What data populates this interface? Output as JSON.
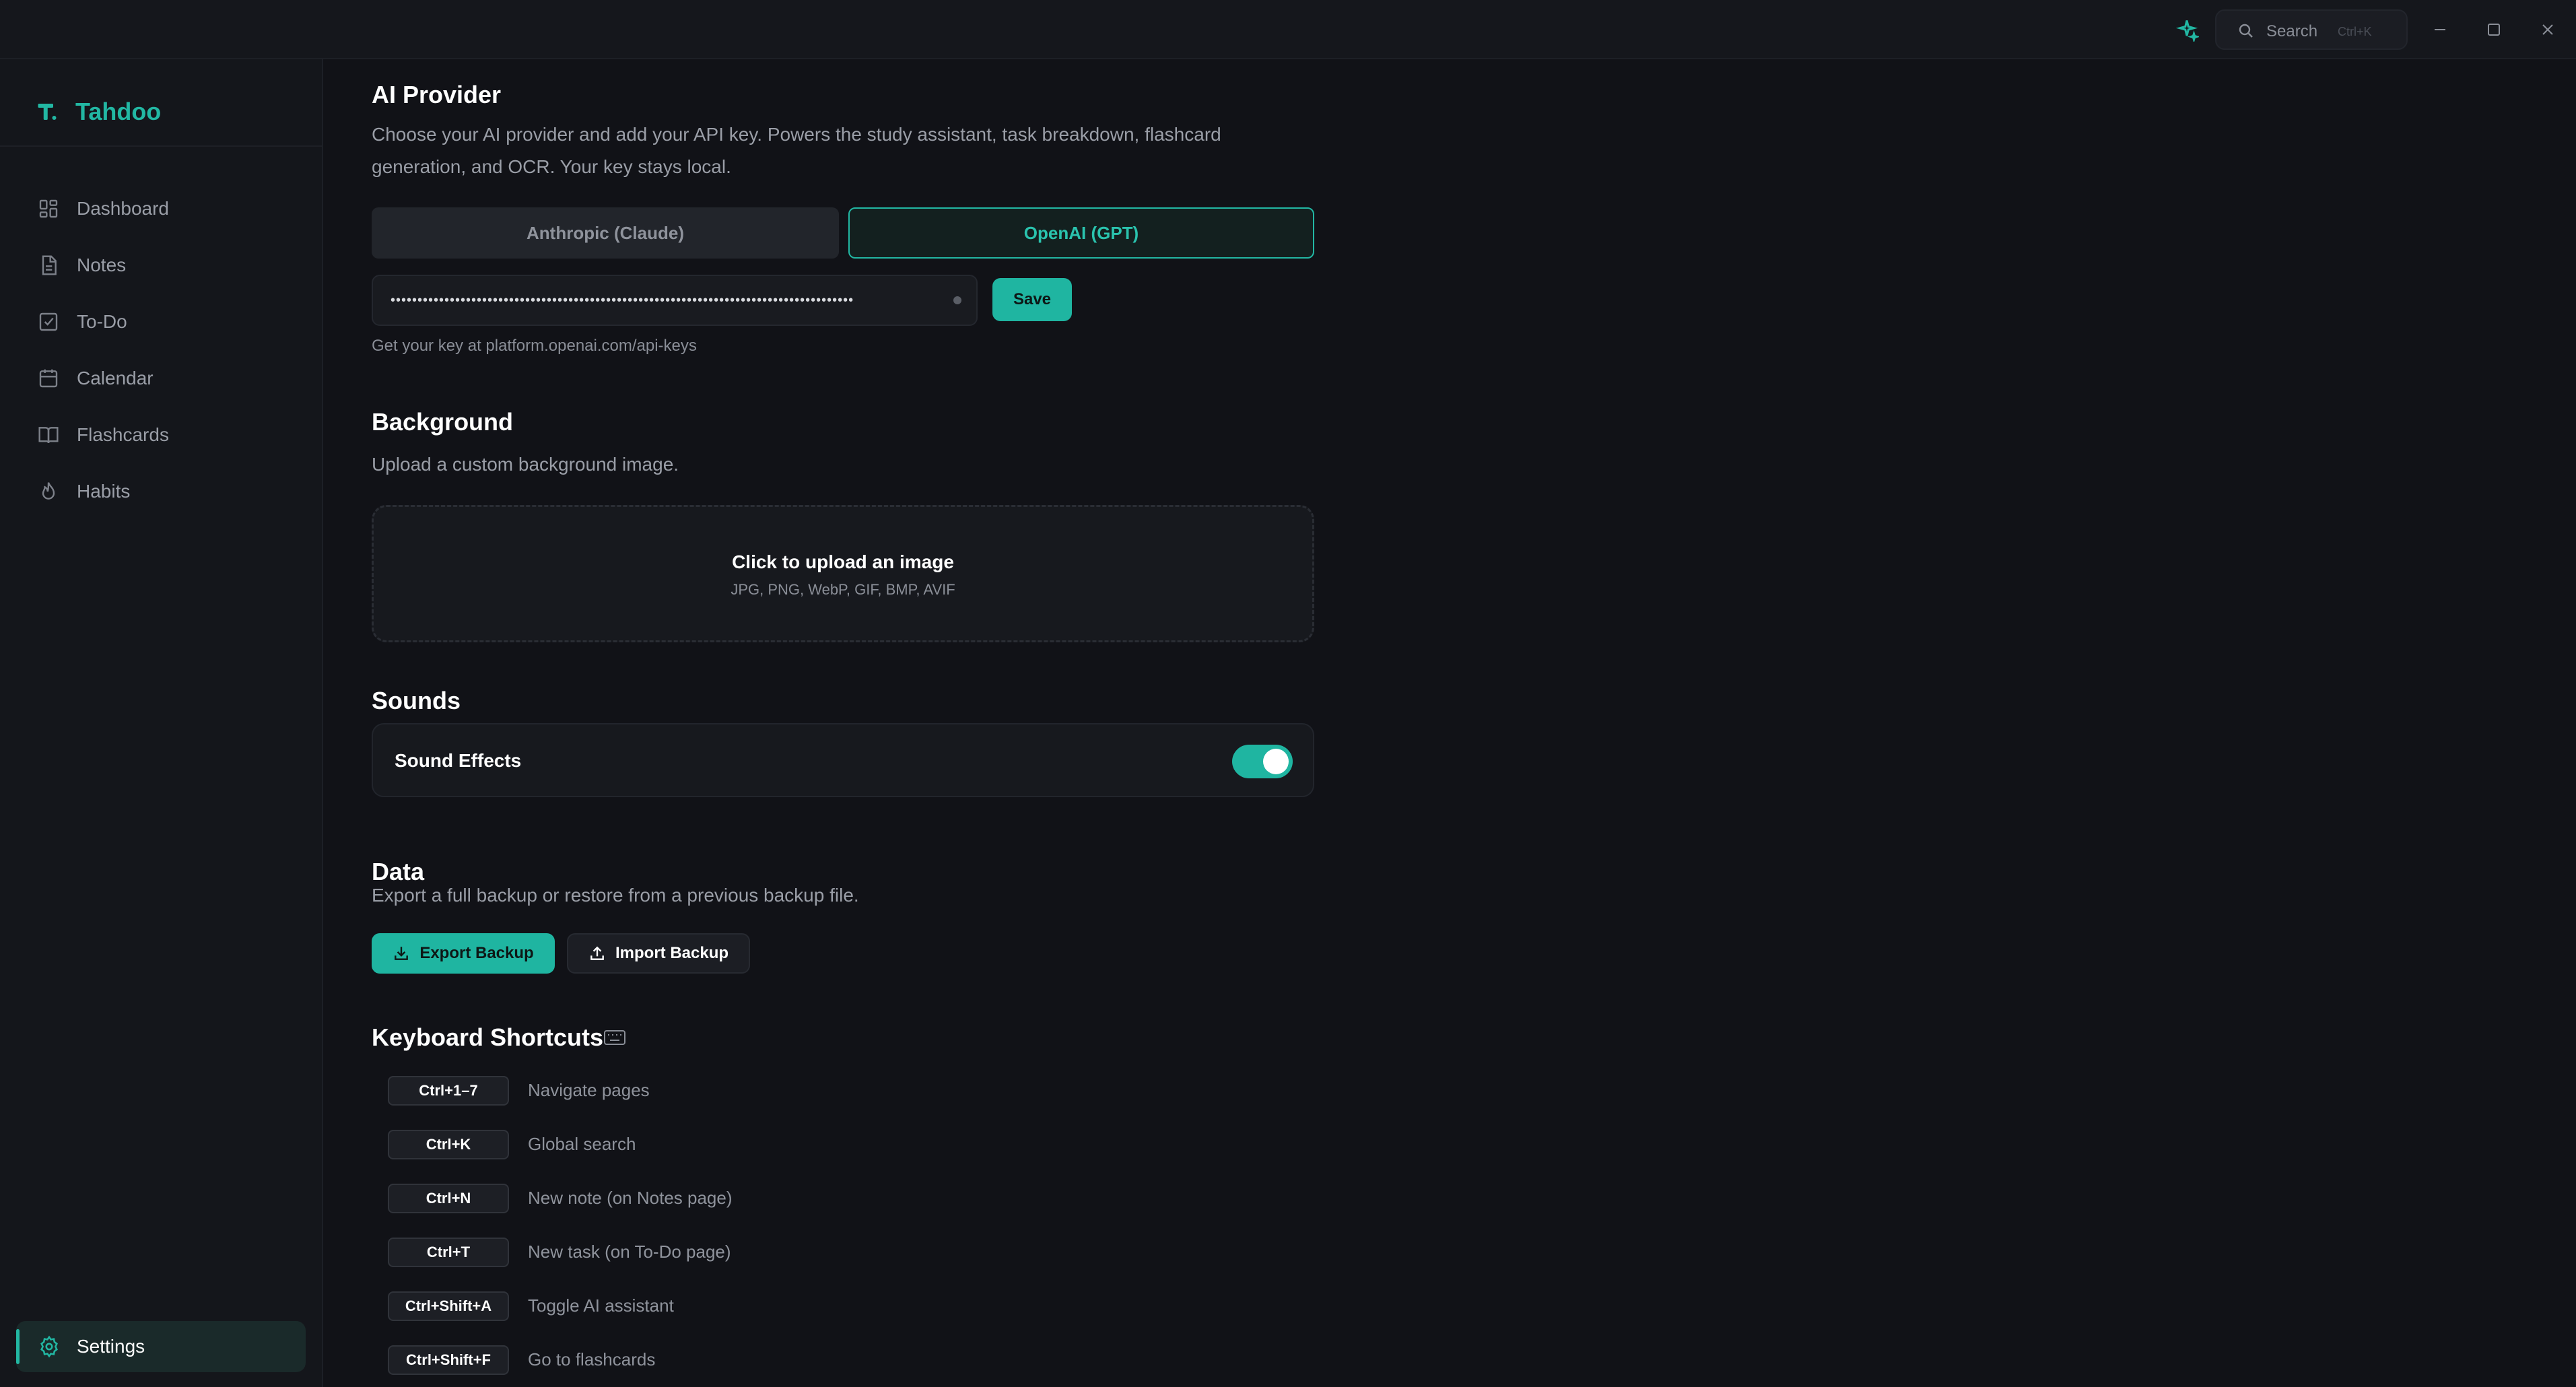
{
  "titlebar": {
    "search_label": "Search",
    "search_shortcut": "Ctrl+K"
  },
  "sidebar": {
    "brand": "Tahdoo",
    "items": [
      {
        "label": "Dashboard",
        "icon": "dashboard-icon"
      },
      {
        "label": "Notes",
        "icon": "notes-icon"
      },
      {
        "label": "To-Do",
        "icon": "todo-icon"
      },
      {
        "label": "Calendar",
        "icon": "calendar-icon"
      },
      {
        "label": "Flashcards",
        "icon": "flashcards-icon"
      },
      {
        "label": "Habits",
        "icon": "habits-icon"
      }
    ],
    "settings_label": "Settings"
  },
  "ai_provider": {
    "title": "AI Provider",
    "description": "Choose your AI provider and add your API key. Powers the study assistant, task breakdown, flashcard generation, and OCR. Your key stays local.",
    "tabs": [
      "Anthropic (Claude)",
      "OpenAI (GPT)"
    ],
    "selected_tab": "OpenAI (GPT)",
    "api_key_masked": "••••••••••••••••••••••••••••••••••••••••••••••••••••••••••••••••••••••••••••••••••••••",
    "save_label": "Save",
    "hint": "Get your key at platform.openai.com/api-keys"
  },
  "background": {
    "title": "Background",
    "description": "Upload a custom background image.",
    "upload_title": "Click to upload an image",
    "upload_formats": "JPG, PNG, WebP, GIF, BMP, AVIF"
  },
  "sounds": {
    "title": "Sounds",
    "sound_effects_label": "Sound Effects",
    "sound_effects_enabled": true
  },
  "data": {
    "title": "Data",
    "description": "Export a full backup or restore from a previous backup file.",
    "export_label": "Export Backup",
    "import_label": "Import Backup"
  },
  "shortcuts": {
    "title": "Keyboard Shortcuts",
    "items": [
      {
        "key": "Ctrl+1–7",
        "desc": "Navigate pages"
      },
      {
        "key": "Ctrl+K",
        "desc": "Global search"
      },
      {
        "key": "Ctrl+N",
        "desc": "New note (on Notes page)"
      },
      {
        "key": "Ctrl+T",
        "desc": "New task (on To-Do page)"
      },
      {
        "key": "Ctrl+Shift+A",
        "desc": "Toggle AI assistant"
      },
      {
        "key": "Ctrl+Shift+F",
        "desc": "Go to flashcards"
      }
    ]
  },
  "colors": {
    "accent": "#22b7a3",
    "background": "#111217",
    "sidebar": "#14161b"
  }
}
